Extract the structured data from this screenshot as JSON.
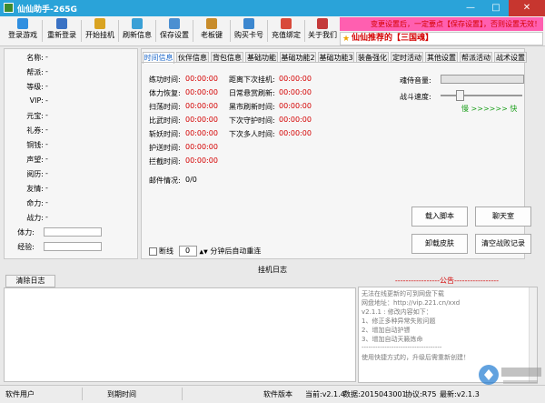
{
  "window": {
    "title": "仙仙助手-265G",
    "min": "—",
    "max": "□",
    "close": "✕"
  },
  "toolbar": [
    {
      "label": "登录游戏",
      "color": "#2f8fe0"
    },
    {
      "label": "重新登录",
      "color": "#3a72c4"
    },
    {
      "label": "开始挂机",
      "color": "#d9a321"
    },
    {
      "label": "刷新信息",
      "color": "#3aa0d6"
    },
    {
      "label": "保存设置",
      "color": "#4b8fd1"
    },
    {
      "label": "老板键",
      "color": "#c88c2b"
    },
    {
      "label": "购买卡号",
      "color": "#3c87cf"
    },
    {
      "label": "充值绑定",
      "color": "#d84a3a"
    },
    {
      "label": "关于我们",
      "color": "#c43a3a"
    }
  ],
  "notice": "变更设置后，一定要点【保存设置】，否则设置无效！",
  "promo": {
    "text": "仙仙推荐的【三国魂】"
  },
  "status_fields": [
    {
      "label": "名称:",
      "value": "-"
    },
    {
      "label": "帮派:",
      "value": "-"
    },
    {
      "label": "等级:",
      "value": "-"
    },
    {
      "label": "VIP:",
      "value": "-"
    },
    {
      "label": "元宝:",
      "value": "-"
    },
    {
      "label": "礼券:",
      "value": "-"
    },
    {
      "label": "铜钱:",
      "value": "-"
    },
    {
      "label": "声望:",
      "value": "-"
    },
    {
      "label": "阅历:",
      "value": "-"
    },
    {
      "label": "友情:",
      "value": "-"
    },
    {
      "label": "命力:",
      "value": "-"
    },
    {
      "label": "战力:",
      "value": "-"
    }
  ],
  "status_bars": [
    {
      "label": "体力:"
    },
    {
      "label": "经验:"
    }
  ],
  "tabs": [
    "时间信息",
    "伙伴信息",
    "背包信息",
    "基础功能",
    "基础功能2",
    "基础功能3",
    "装备强化",
    "定时活动",
    "其他设置",
    "帮派活动",
    "战术设置"
  ],
  "time_info_left": [
    {
      "label": "练功时间:",
      "value": "00:00:00"
    },
    {
      "label": "体力恢复:",
      "value": "00:00:00"
    },
    {
      "label": "扫荡时间:",
      "value": "00:00:00"
    },
    {
      "label": "比武时间:",
      "value": "00:00:00"
    },
    {
      "label": "斩妖时间:",
      "value": "00:00:00"
    },
    {
      "label": "护送时间:",
      "value": "00:00:00"
    },
    {
      "label": "拦截时间:",
      "value": "00:00:00"
    }
  ],
  "time_info_right": [
    {
      "label": "距离下次挂机:",
      "value": "00:00:00"
    },
    {
      "label": "日常悬赏刷新:",
      "value": "00:00:00"
    },
    {
      "label": "黑市刷新时间:",
      "value": "00:00:00"
    },
    {
      "label": "下次守护时间:",
      "value": "00:00:00"
    },
    {
      "label": "下次多人时间:",
      "value": "00:00:00"
    }
  ],
  "mail": {
    "label": "邮件情况:",
    "value": "0/0"
  },
  "volume_label": "魂侍音量:",
  "speed": {
    "label": "战斗速度:",
    "slow": "慢",
    "arrows": ">>>>>>",
    "fast": "快"
  },
  "buttons": {
    "load_script": "载入脚本",
    "chat": "聊天室",
    "unload_skin": "卸载皮肤",
    "clear_battle": "清空战败记录"
  },
  "disconnect": {
    "label": "断线",
    "minutes": "0",
    "suffix": "分钟后自动重连"
  },
  "log": {
    "title": "挂机日志",
    "clear": "清除日志"
  },
  "announcement": {
    "head": "-----------------公告-----------------",
    "lines": [
      "无法在线更新的可到网盘下载",
      "网盘地址：http://vip.221.cn/xxd",
      "v2.1.1 : 修改内容如下：",
      "1、修正多种异常失败问题",
      "2、增加自动护镖",
      "3、增加自动天籁炼命",
      "-----------------------------------",
      "使用快捷方式的，升级后需重新创建！"
    ]
  },
  "statusbar": {
    "user_label": "软件用户",
    "expire_label": "到期时间",
    "version_label": "软件版本",
    "current": "当前:v2.1.4",
    "data": "数据:2015043001",
    "protocol": "协议:R75",
    "latest": "最新:v2.1.3"
  }
}
